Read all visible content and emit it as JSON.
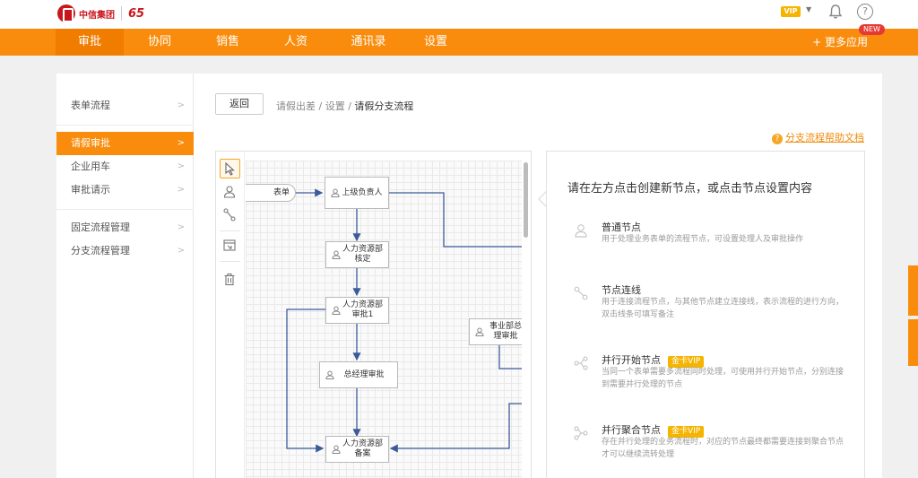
{
  "header": {
    "logo_text": "中信集团",
    "anniversary": "65",
    "vip_label": "VIP",
    "help_symbol": "?"
  },
  "nav": {
    "items": [
      {
        "label": "审批",
        "active": true
      },
      {
        "label": "协同"
      },
      {
        "label": "销售"
      },
      {
        "label": "人资"
      },
      {
        "label": "通讯录"
      },
      {
        "label": "设置"
      }
    ],
    "more_apps": "+ 更多应用",
    "new_badge": "NEW"
  },
  "sidebar": {
    "items": [
      {
        "label": "表单流程"
      },
      {
        "label": "请假审批",
        "active": true
      },
      {
        "label": "企业用车"
      },
      {
        "label": "审批请示"
      },
      {
        "label": "固定流程管理"
      },
      {
        "label": "分支流程管理"
      }
    ]
  },
  "toolbar": {
    "back_label": "返回"
  },
  "breadcrumb": {
    "part1": "请假出差",
    "part2": "设置",
    "current": "请假分支流程",
    "separator": " / "
  },
  "help_link": "分支流程帮助文档",
  "flow": {
    "start_label": "表单",
    "nodes": [
      {
        "label": "上级负责人"
      },
      {
        "label": "人力资源部\n核定"
      },
      {
        "label": "人力资源部\n审批1"
      },
      {
        "label": "总经理审批"
      },
      {
        "label": "人力资源部\n备案"
      },
      {
        "label": "事业部总\n理审批"
      }
    ]
  },
  "panel": {
    "title": "请在左方点击创建新节点，或点击节点设置内容",
    "items": [
      {
        "title": "普通节点",
        "desc": "用于处理业务表单的流程节点，可设置处理人及审批操作",
        "icon": "user-icon"
      },
      {
        "title": "节点连线",
        "desc": "用于连接流程节点，与其他节点建立连接线，表示流程的进行方向，双击线条可填写备注",
        "icon": "link-icon"
      },
      {
        "title": "并行开始节点",
        "badge": "金卡VIP",
        "desc": "当同一个表单需要多流程同时处理，可使用并行开始节点，分别连接到需要并行处理的节点",
        "icon": "split-icon"
      },
      {
        "title": "并行聚合节点",
        "badge": "金卡VIP",
        "desc": "存在并行处理的业务流程时，对应的节点最终都需要连接到聚合节点才可以继续流转处理",
        "icon": "merge-icon"
      }
    ]
  },
  "colors": {
    "brand_orange": "#f98c0c",
    "logo_red": "#c8161d",
    "vip_gold": "#f5b400",
    "flow_line": "#3a5a9a"
  }
}
